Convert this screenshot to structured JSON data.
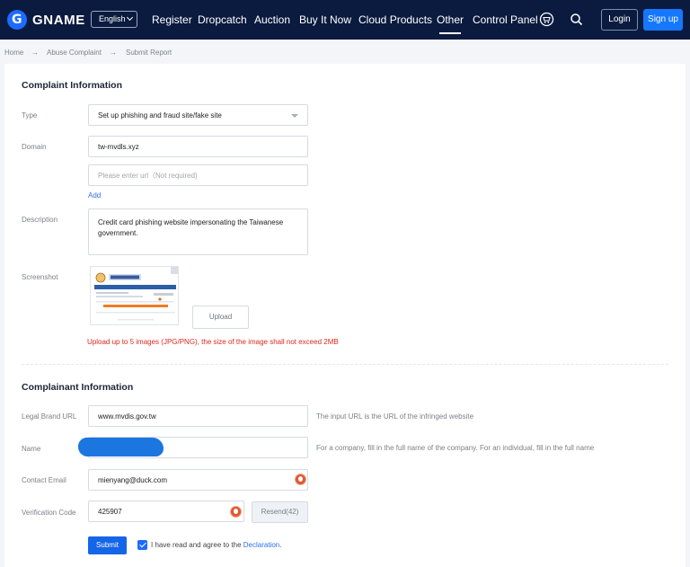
{
  "header": {
    "brand": "GNAME",
    "language": "English",
    "nav": [
      "Register",
      "Dropcatch",
      "Auction",
      "Buy It Now",
      "Cloud Products",
      "Other",
      "Control Panel"
    ],
    "active_nav": "Other",
    "login": "Login",
    "signup": "Sign up"
  },
  "breadcrumb": [
    "Home",
    "Abuse Complaint",
    "Submit Report"
  ],
  "complaint": {
    "title": "Complaint Information",
    "type_label": "Type",
    "type_value": "Set up phishing and fraud site/fake site",
    "domain_label": "Domain",
    "domain_value": "tw-mvdls.xyz",
    "url_placeholder": "Please enter url（Not required)",
    "add": "Add",
    "description_label": "Description",
    "description_value": "Credit card phishing website impersonating the Taiwanese government.",
    "screenshot_label": "Screenshot",
    "upload": "Upload",
    "upload_hint": "Upload up to 5 images (JPG/PNG), the size of the image shall not exceed 2MB"
  },
  "complainant": {
    "title": "Complainant Information",
    "brand_url_label": "Legal Brand URL",
    "brand_url_value": "www.mvdis.gov.tw",
    "brand_url_hint": "The input URL is the URL of the infringed website",
    "name_label": "Name",
    "name_hint": "For a company, fill in the full name of the company. For an individual, fill in the full name",
    "email_label": "Contact Email",
    "email_value": "mienyang@duck.com",
    "code_label": "Verification Code",
    "code_value": "425907",
    "resend": "Resend(42)",
    "submit": "Submit",
    "agree_text": "I have read and agree to the",
    "declaration": "Declaration",
    "agree_end": "."
  },
  "colors": {
    "nav_bg": "#0b1b3f",
    "accent": "#1677ff",
    "error": "#e0281f",
    "duckduckgo": "#de5833"
  }
}
